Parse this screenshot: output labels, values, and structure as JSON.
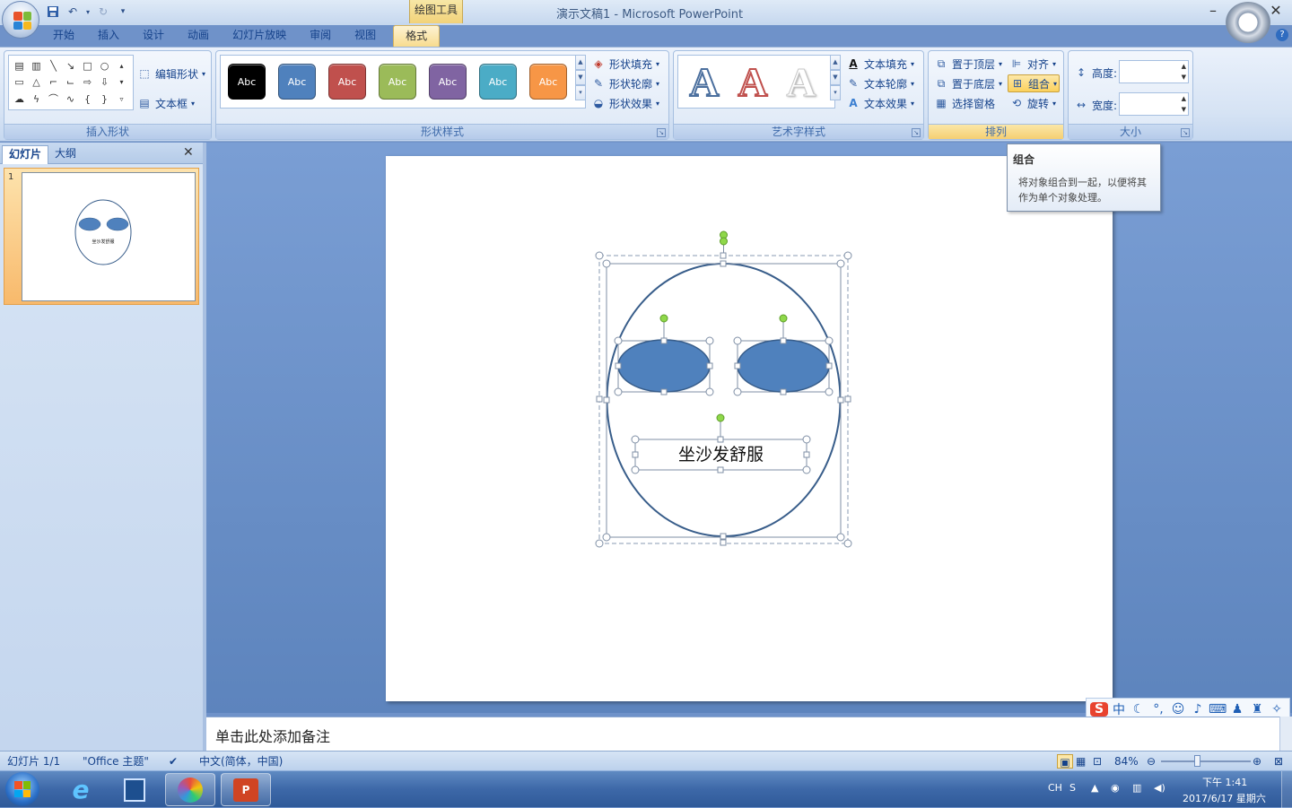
{
  "window": {
    "title": "演示文稿1 - Microsoft PowerPoint",
    "contextual_tab_group": "绘图工具"
  },
  "quick_access": {
    "save_icon": "save-icon",
    "undo_icon": "undo-icon",
    "redo_icon": "redo-icon",
    "customize_icon": "customize-icon"
  },
  "tabs": [
    "开始",
    "插入",
    "设计",
    "动画",
    "幻灯片放映",
    "审阅",
    "视图",
    "格式"
  ],
  "active_tab": "格式",
  "ribbon": {
    "insert_shapes": {
      "label": "插入形状",
      "edit_shape": "编辑形状",
      "textbox": "文本框"
    },
    "shape_styles": {
      "label": "形状样式",
      "swatches": [
        {
          "text": "Abc",
          "color": "#000000"
        },
        {
          "text": "Abc",
          "color": "#4f81bd"
        },
        {
          "text": "Abc",
          "color": "#c0504d"
        },
        {
          "text": "Abc",
          "color": "#9bbb59"
        },
        {
          "text": "Abc",
          "color": "#8064a2"
        },
        {
          "text": "Abc",
          "color": "#4bacc6"
        },
        {
          "text": "Abc",
          "color": "#f79646"
        }
      ],
      "fill": "形状填充",
      "outline": "形状轮廓",
      "effects": "形状效果"
    },
    "wordart_styles": {
      "label": "艺术字样式",
      "text_fill": "文本填充",
      "text_outline": "文本轮廓",
      "text_effects": "文本效果",
      "sample": "A"
    },
    "arrange": {
      "label": "排列",
      "bring_front": "置于顶层",
      "send_back": "置于底层",
      "selection_pane": "选择窗格",
      "align": "对齐",
      "group": "组合",
      "rotate": "旋转"
    },
    "size": {
      "label": "大小",
      "height_label": "高度:",
      "width_label": "宽度:",
      "height_value": "",
      "width_value": ""
    }
  },
  "tooltip": {
    "title": "组合",
    "body": "将对象组合到一起，以便将其作为单个对象处理。"
  },
  "left_panel": {
    "tab_slides": "幻灯片",
    "tab_outline": "大纲",
    "slide_number": "1",
    "thumb_text": "坐沙发舒服"
  },
  "slide": {
    "textbox_text": "坐沙发舒服",
    "face_color": "#ffffff",
    "eye_color": "#4f81bd",
    "outline_color": "#385d8a"
  },
  "notes": {
    "placeholder": "单击此处添加备注"
  },
  "status": {
    "slide_count": "幻灯片 1/1",
    "theme": "\"Office 主题\"",
    "language": "中文(简体，中国)",
    "zoom": "84%"
  },
  "ime": {
    "mode": "中"
  },
  "tray": {
    "lang": "CH",
    "time": "下午 1:41",
    "date": "2017/6/17 星期六"
  }
}
